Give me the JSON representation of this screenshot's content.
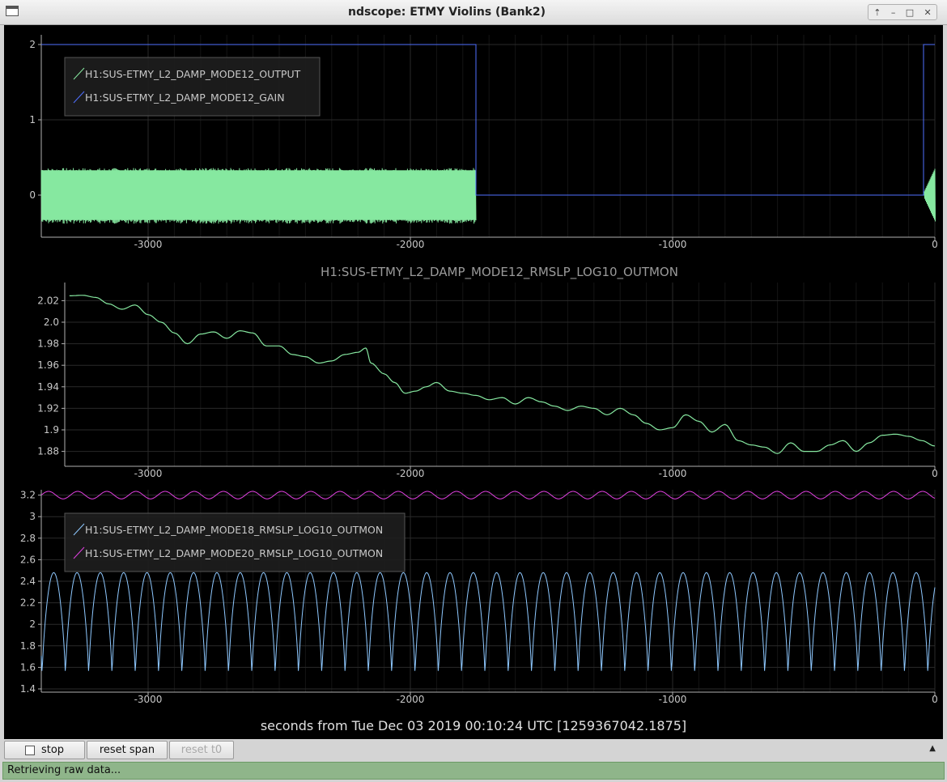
{
  "window": {
    "title": "ndscope: ETMY Violins (Bank2)"
  },
  "plots": [
    {
      "title": "",
      "x_ticks": [
        "-3000",
        "-2000",
        "-1000",
        "0"
      ],
      "y_ticks": [
        "0",
        "1",
        "2"
      ],
      "legend": [
        "H1:SUS-ETMY_L2_DAMP_MODE12_OUTPUT",
        "H1:SUS-ETMY_L2_DAMP_MODE12_GAIN"
      ]
    },
    {
      "title": "H1:SUS-ETMY_L2_DAMP_MODE12_RMSLP_LOG10_OUTMON",
      "x_ticks": [
        "-3000",
        "-2000",
        "-1000",
        "0"
      ],
      "y_ticks": [
        "1.88",
        "1.9",
        "1.92",
        "1.94",
        "1.96",
        "1.98",
        "2.0",
        "2.02"
      ]
    },
    {
      "title": "",
      "x_ticks": [
        "-3000",
        "-2000",
        "-1000",
        "0"
      ],
      "y_ticks": [
        "1.4",
        "1.6",
        "1.8",
        "2",
        "2.2",
        "2.4",
        "2.6",
        "2.8",
        "3",
        "3.2"
      ],
      "legend": [
        "H1:SUS-ETMY_L2_DAMP_MODE18_RMSLP_LOG10_OUTMON",
        "H1:SUS-ETMY_L2_DAMP_MODE20_RMSLP_LOG10_OUTMON"
      ]
    }
  ],
  "x_axis_label": "seconds from Tue Dec 03 2019 00:10:24 UTC [1259367042.1875]",
  "buttons": {
    "stop": "stop",
    "reset_span": "reset span",
    "reset_t0": "reset t0"
  },
  "status": "Retrieving raw data...",
  "colors": {
    "green_trace": "#86e8a0",
    "blue_trace": "#4f6fff",
    "cyan_trace": "#8ec8ff",
    "magenta_trace": "#e040e0",
    "status_bar": "#8fb58a",
    "background": "#000000"
  },
  "icons": {
    "window": "window-menu-icon",
    "minimize": "minimize-icon",
    "maximize": "maximize-icon",
    "close": "close-icon",
    "shade": "shade-up-icon",
    "collapse": "collapse-arrow-icon"
  }
}
